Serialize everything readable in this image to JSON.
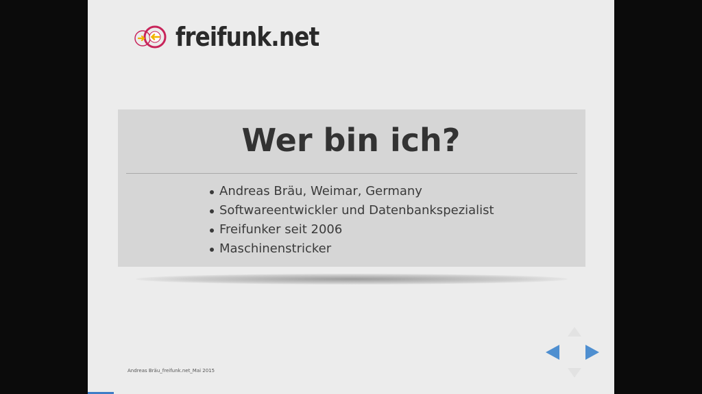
{
  "logo": {
    "text": "freifunk.net",
    "mark_colors": {
      "ring": "#c8245a",
      "arrow": "#f0b400"
    }
  },
  "slide": {
    "title": "Wer bin ich?",
    "bullets": [
      "Andreas Bräu, Weimar, Germany",
      "Softwareentwickler und Datenbankspezialist",
      "Freifunker seit 2006",
      "Maschinenstricker"
    ],
    "footer": "Andreas Bräu_freifunk.net_Mai 2015"
  },
  "navigation": {
    "icons": [
      "nav-up-icon",
      "nav-left-icon",
      "nav-right-icon",
      "nav-down-icon"
    ],
    "active_color": "#4f8fd0"
  },
  "progress": {
    "fraction": 0.05,
    "color": "#3d7cc6"
  }
}
